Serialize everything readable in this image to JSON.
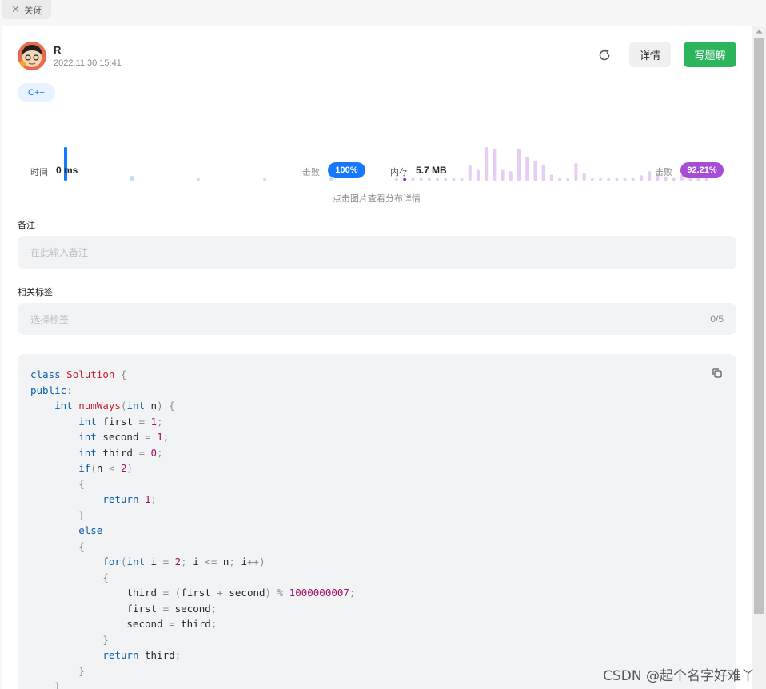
{
  "topbar": {
    "close_label": "关闭",
    "close_icon": "close-icon"
  },
  "submission": {
    "user_name": "R",
    "time": "2022.11.30 15:41",
    "detail_button": "详情",
    "write_solution_button": "写题解",
    "language": "C++"
  },
  "stats": {
    "time_label": "时间",
    "time_value": "0 ms",
    "time_beat_label": "击败",
    "time_beat": "100%",
    "memory_label": "内存",
    "memory_value": "5.7 MB",
    "memory_beat_label": "击败",
    "memory_beat": "92.21%",
    "hint": "点击图片查看分布详情"
  },
  "chart_data": [
    {
      "type": "bar",
      "title": "",
      "highlight_index": 0,
      "values": [
        100,
        14,
        6,
        6,
        9
      ],
      "color": "#1677ff",
      "faded_color": "#bfdcff"
    },
    {
      "type": "bar",
      "title": "",
      "highlight_index": 1,
      "values": [
        4,
        6,
        4,
        4,
        4,
        4,
        4,
        4,
        4,
        45,
        32,
        100,
        94,
        32,
        28,
        94,
        70,
        60,
        48,
        18,
        6,
        6,
        52,
        22,
        4,
        4,
        4,
        4,
        4,
        6,
        16,
        28,
        24,
        10,
        8,
        18,
        18,
        14,
        6
      ],
      "color": "#7b2cbf",
      "faded_color": "#e6cdf5"
    }
  ],
  "notes": {
    "label": "备注",
    "placeholder": "在此输入备注"
  },
  "tags": {
    "label": "相关标签",
    "placeholder": "选择标签",
    "count": "0/5"
  },
  "code": {
    "lines": [
      "class Solution {",
      "public:",
      "    int numWays(int n) {",
      "        int first = 1;",
      "        int second = 1;",
      "        int third = 0;",
      "        if(n < 2)",
      "        {",
      "            return 1;",
      "        }",
      "        else",
      "        {",
      "            for(int i = 2; i <= n; i++)",
      "            {",
      "                third = (first + second) % 1000000007;",
      "                first = second;",
      "                second = third;",
      "            }",
      "            return third;",
      "        }",
      "    }"
    ]
  },
  "watermark": "CSDN @起个名字好难丫",
  "colors": {
    "accent_green": "#2db55d",
    "accent_blue": "#1677ff",
    "accent_purple": "#a64dd6"
  }
}
